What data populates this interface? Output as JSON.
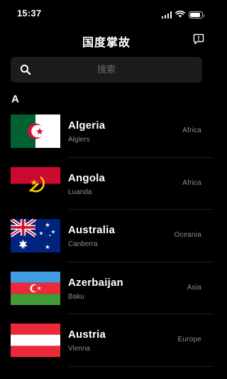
{
  "status_bar": {
    "time": "15:37",
    "battery_level": 0.85,
    "icons": [
      "signal-icon",
      "wifi-icon",
      "battery-icon"
    ]
  },
  "nav": {
    "title": "国度掌故",
    "action_icon": "feedback-icon"
  },
  "search": {
    "placeholder": "搜索",
    "value": "",
    "icon": "search-icon"
  },
  "sections": [
    {
      "header": "A",
      "countries": [
        {
          "name": "Algeria",
          "capital": "Algiers",
          "continent": "Africa",
          "flag_icon": "algeria-flag-icon"
        },
        {
          "name": "Angola",
          "capital": "Luanda",
          "continent": "Africa",
          "flag_icon": "angola-flag-icon"
        },
        {
          "name": "Australia",
          "capital": "Canberra",
          "continent": "Oceania",
          "flag_icon": "australia-flag-icon"
        },
        {
          "name": "Azerbaijan",
          "capital": "Baku",
          "continent": "Asia",
          "flag_icon": "azerbaijan-flag-icon"
        },
        {
          "name": "Austria",
          "capital": "Vienna",
          "continent": "Europe",
          "flag_icon": "austria-flag-icon"
        }
      ]
    }
  ],
  "colors": {
    "background": "#000000",
    "search_background": "#1c1c1e",
    "secondary_text": "#8e8e93"
  }
}
